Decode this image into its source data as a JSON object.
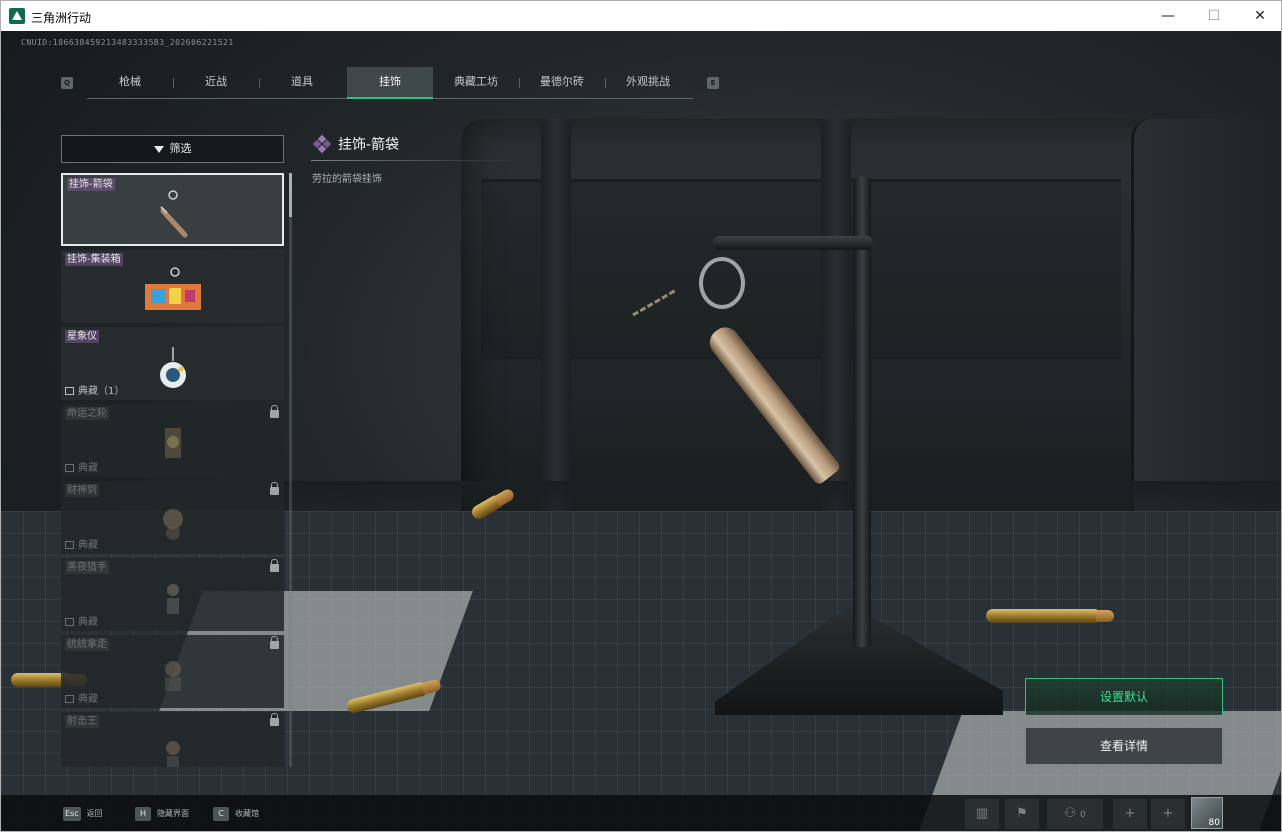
{
  "window": {
    "title": "三角洲行动",
    "minimize_glyph": "—",
    "maximize_glyph": "☐",
    "close_glyph": "✕"
  },
  "uid_text": "CNUID:1866384592134833335B3_202606221521",
  "nav": {
    "left_key": "Q",
    "right_key": "E",
    "tabs": [
      {
        "label": "枪械"
      },
      {
        "label": "近战"
      },
      {
        "label": "道具"
      },
      {
        "label": "挂饰",
        "active": true
      },
      {
        "label": "典藏工坊"
      },
      {
        "label": "曼德尔砖"
      },
      {
        "label": "外观挑战"
      }
    ]
  },
  "filter_label": "筛选",
  "items": [
    {
      "label": "挂饰-箭袋",
      "collection": "",
      "locked": false,
      "selected": true,
      "icon": "quiver-charm"
    },
    {
      "label": "挂饰-集装箱",
      "collection": "",
      "locked": false,
      "selected": false,
      "icon": "container-charm"
    },
    {
      "label": "星象仪",
      "collection": "典藏（1）",
      "locked": false,
      "selected": false,
      "icon": "astrolabe-charm"
    },
    {
      "label": "命运之轮",
      "collection": "典藏",
      "locked": true,
      "selected": false,
      "icon": "wheel-charm"
    },
    {
      "label": "财神到",
      "collection": "典藏",
      "locked": true,
      "selected": false,
      "icon": "fortune-charm"
    },
    {
      "label": "黑夜猎手",
      "collection": "典藏",
      "locked": true,
      "selected": false,
      "icon": "hunter-charm"
    },
    {
      "label": "统统拿走",
      "collection": "典藏",
      "locked": true,
      "selected": false,
      "icon": "loot-charm"
    },
    {
      "label": "射击王",
      "collection": "",
      "locked": true,
      "selected": false,
      "icon": "shooter-charm"
    }
  ],
  "detail": {
    "title": "挂饰-箭袋",
    "description": "劳拉的箭袋挂饰"
  },
  "buttons": {
    "set_default": "设置默认",
    "view_details": "查看详情"
  },
  "bottom_hints": [
    {
      "key": "Esc",
      "label": "返回"
    },
    {
      "key": "H",
      "label": "隐藏界面"
    },
    {
      "key": "C",
      "label": "收藏馆"
    }
  ],
  "bottom_right": {
    "party_count": "0",
    "level": "80"
  },
  "colors": {
    "accent": "#2ec27e",
    "rarity_purple": "#7a5a8c"
  }
}
